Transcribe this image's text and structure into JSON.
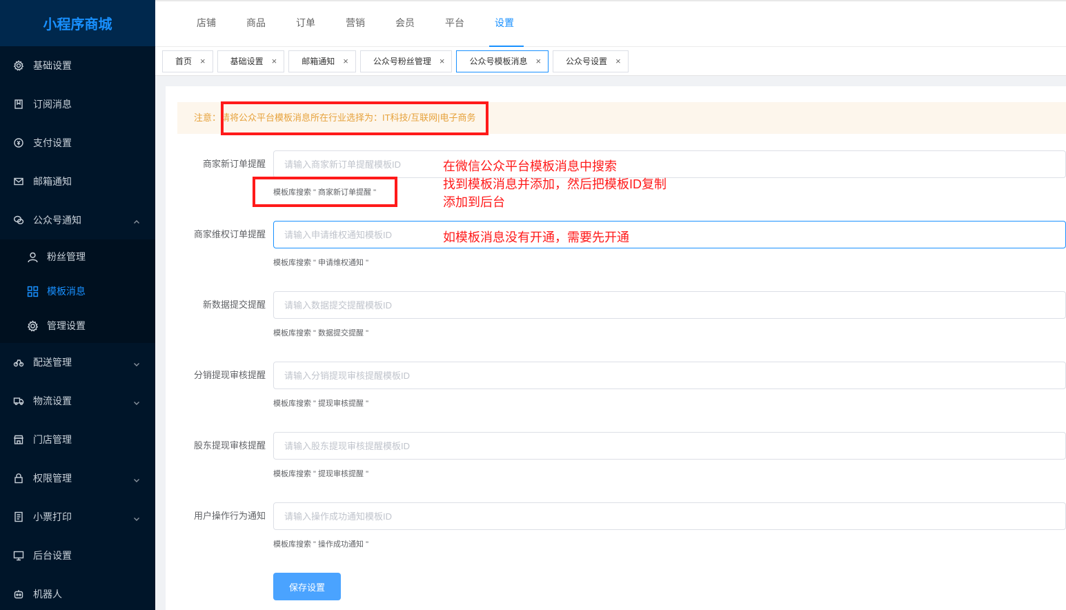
{
  "sidebar": {
    "logo": "小程序商城",
    "items": [
      {
        "label": "基础设置",
        "icon": "gear-icon"
      },
      {
        "label": "订阅消息",
        "icon": "bookmark-icon"
      },
      {
        "label": "支付设置",
        "icon": "payment-icon"
      },
      {
        "label": "邮箱通知",
        "icon": "mail-icon"
      },
      {
        "label": "公众号通知",
        "icon": "wechat-icon",
        "expanded": true
      }
    ],
    "subitems": [
      {
        "label": "粉丝管理",
        "icon": "user-icon"
      },
      {
        "label": "模板消息",
        "icon": "grid-icon",
        "active": true
      },
      {
        "label": "管理设置",
        "icon": "gear-icon"
      }
    ],
    "items_after": [
      {
        "label": "配送管理",
        "icon": "bike-icon",
        "has_arrow": true
      },
      {
        "label": "物流设置",
        "icon": "truck-icon",
        "has_arrow": true
      },
      {
        "label": "门店管理",
        "icon": "store-icon",
        "has_arrow": false
      },
      {
        "label": "权限管理",
        "icon": "lock-icon",
        "has_arrow": true
      },
      {
        "label": "小票打印",
        "icon": "receipt-icon",
        "has_arrow": true
      },
      {
        "label": "后台设置",
        "icon": "monitor-icon",
        "has_arrow": false
      },
      {
        "label": "机器人",
        "icon": "robot-icon",
        "has_arrow": false
      }
    ]
  },
  "topnav": {
    "items": [
      "店铺",
      "商品",
      "订单",
      "营销",
      "会员",
      "平台",
      "设置"
    ],
    "active_index": 6
  },
  "tabs": [
    {
      "label": "首页"
    },
    {
      "label": "基础设置"
    },
    {
      "label": "邮箱通知"
    },
    {
      "label": "公众号粉丝管理"
    },
    {
      "label": "公众号模板消息",
      "active": true
    },
    {
      "label": "公众号设置"
    }
  ],
  "tab_close_glyph": "×",
  "notice": {
    "text": "注意：请将公众平台模板消息所在行业选择为：IT科技/互联网|电子商务"
  },
  "form": {
    "rows": [
      {
        "label": "商家新订单提醒",
        "placeholder": "请输入商家新订单提醒模板ID",
        "hint": "模板库搜索 \" 商家新订单提醒 \""
      },
      {
        "label": "商家维权订单提醒",
        "placeholder": "请输入申请维权通知模板ID",
        "hint": "模板库搜索 \" 申请维权通知 \"",
        "focused": true
      },
      {
        "label": "新数据提交提醒",
        "placeholder": "请输入数据提交提醒模板ID",
        "hint": "模板库搜索 \" 数据提交提醒 \""
      },
      {
        "label": "分销提现审核提醒",
        "placeholder": "请输入分销提现审核提醒模板ID",
        "hint": "模板库搜索 \" 提现审核提醒 \""
      },
      {
        "label": "股东提现审核提醒",
        "placeholder": "请输入股东提现审核提醒模板ID",
        "hint": "模板库搜索 \" 提现审核提醒 \""
      },
      {
        "label": "用户操作行为通知",
        "placeholder": "请输入操作成功通知模板ID",
        "hint": "模板库搜索 \" 操作成功通知 \""
      }
    ],
    "save_label": "保存设置"
  },
  "annotations": {
    "line1": "在微信公众平台模板消息中搜索",
    "line2": "找到模板消息并添加，然后把模板ID复制",
    "line3": "添加到后台",
    "line4": "如模板消息没有开通，需要先开通"
  },
  "colors": {
    "sidebar_bg": "#001529",
    "accent": "#1890ff",
    "notice_text": "#e6a23c",
    "annotation": "#ff1a1a"
  }
}
